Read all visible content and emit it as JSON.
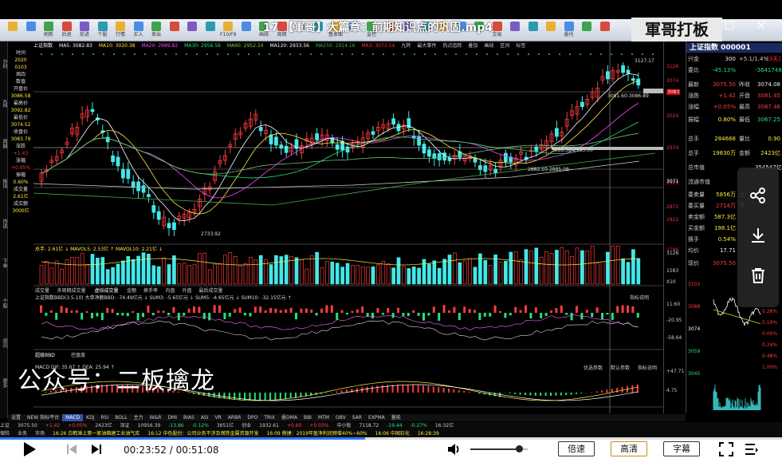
{
  "video": {
    "title": "17 【軍哥】大篇章：前期知识点的巩固.mp4",
    "watermark": "軍哥打板",
    "overlay_text": "公众号：二板擒龙",
    "current_time": "00:23:52",
    "total_time": "00:51:08",
    "progress": 0.467,
    "volume": 0.85,
    "buttons": {
      "speed": "倍速",
      "quality": "高清",
      "subtitle": "字幕"
    }
  },
  "toolbar": {
    "items": [
      "",
      "",
      "刷新",
      "后退",
      "前进",
      "个股",
      "行情",
      "买入",
      "卖出",
      "",
      "",
      "",
      "F10/F9",
      "",
      "画线",
      "周期",
      "",
      "",
      "基本面",
      "",
      "监控",
      "",
      "",
      "",
      "",
      "",
      "",
      "交易",
      "",
      "",
      "",
      "委托",
      "",
      "",
      "",
      "",
      "",
      "F9",
      "",
      "",
      "",
      "",
      "资讯",
      "",
      "",
      "",
      "",
      "",
      "",
      "",
      "",
      "",
      "",
      "",
      "",
      "",
      "",
      "",
      "",
      "",
      "",
      "",
      "",
      "",
      "",
      "",
      "",
      "",
      "",
      "",
      "",
      "",
      "",
      "",
      "",
      "",
      "",
      "",
      "",
      "",
      "",
      "",
      "",
      "",
      "",
      "",
      "",
      "",
      "",
      "",
      "",
      "",
      "",
      "",
      "",
      "",
      "",
      "",
      "",
      "",
      "",
      "",
      "",
      "",
      "",
      "",
      "",
      "",
      "",
      "",
      "",
      "",
      "",
      "",
      "",
      "",
      "",
      "",
      "",
      "",
      "",
      "",
      "",
      "",
      "",
      "",
      "",
      "",
      "",
      "",
      "",
      "",
      "",
      "",
      "",
      "",
      "",
      "",
      "",
      "",
      "",
      "",
      "",
      "",
      "",
      "",
      "",
      "",
      "",
      ""
    ]
  },
  "left_strip": {
    "items": [
      "分时",
      "K线",
      "周期",
      "板块",
      "自选",
      "下单",
      "个股",
      "资讯",
      "更多"
    ]
  },
  "left_info": {
    "lines": [
      "时间",
      "2020",
      "0103",
      "周四",
      "数值",
      "开盘价",
      "3086.58",
      "最高价",
      "3092.82",
      "最低价",
      "3074.52",
      "收盘价",
      "3083.79",
      "涨跌",
      "+1.43",
      "涨幅",
      "+0.05%",
      "振幅",
      "0.60%",
      "成交量",
      "2.61亿",
      "成交额",
      "3000亿"
    ]
  },
  "chart_header": {
    "name": "上证指数",
    "ma5": "MA5: 3082.83",
    "ma10": "MA10: 3020.38",
    "ma20": "MA20: 2989.82",
    "ma30": "MA30: 2956.59",
    "ma60": "MA60: 2952.24",
    "ma120": "MA120: 2933.56",
    "ma250": "MA250: 2914.16",
    "ma3": "MA3: 3073.54",
    "right_tabs": [
      "九转",
      "最大事件",
      "热点追踪",
      "叠加",
      "画线",
      "区间",
      "标签"
    ],
    "colors": {
      "ma5": "#ffffff",
      "ma10": "#ffeb3b",
      "ma20": "#ff44ff",
      "ma30": "#26e07a",
      "ma60": "#8bc34a",
      "ma120": "#ffffff",
      "ma250": "#4caf50",
      "ma3": "#ff3333"
    }
  },
  "price_annotations": {
    "high": "3127.17",
    "low": "2733.92",
    "mid1": "3091.60-3086.89",
    "mid2": "3086.58-2935.00",
    "mid3": "2882.50-2885.08"
  },
  "price_axis": {
    "labels": [
      "3126",
      "3074",
      "3024",
      "2974",
      "2923",
      "2872",
      "2822",
      "2796"
    ],
    "current": "3083",
    "marker1": "3071"
  },
  "volume_panel": {
    "header": "总手: 2.61亿 ↓  MAVOL5: 2.53亿 ↑  MAVOL10: 2.21亿 ↓",
    "tabs": [
      "成交量",
      "多周期成交量",
      "虚拟成交量",
      "金额",
      "换手率",
      "内盘",
      "外盘",
      "最后成交量"
    ],
    "axis": [
      "3126",
      "1583",
      "X10"
    ]
  },
  "ddx_panel": {
    "header": "上证指数BBD(3.5.10) 大单净额BBD: -74.49亿元 ↓  SUM3: -5.65亿元 ↓  SUM5: -4.65亿元 ↓  SUM10: -32.15亿元 ↑",
    "side": "指标说明",
    "axis": [
      "11.60",
      "-20.95",
      "-58.64"
    ]
  },
  "macd_panel": {
    "tabs": [
      "超级BBD",
      "控盘度"
    ],
    "header": "MACD  DIF: 35.67 ↑  DEA: 25.94 ↑",
    "buttons": [
      "优选参数",
      "默认参数",
      "指标说明"
    ],
    "axis": [
      "+47.71",
      "4.75"
    ]
  },
  "indicator_tabs": [
    "设置",
    "NEW 指标平台",
    "MACD",
    "KDJ",
    "RSI",
    "BOLL",
    "主力",
    "W&R",
    "DMI",
    "BIAS",
    "ASI",
    "VR",
    "ARBR",
    "DPO",
    "TRIX",
    "曼DMA",
    "BBI",
    "MTM",
    "OBV",
    "SAR",
    "EXPMA",
    "量能"
  ],
  "quote_panel": {
    "title": "上证指数 000001",
    "rows": [
      {
        "k": "兴金",
        "v": "300",
        "k2": "+5.1/1.4%",
        "v2": "[3天]",
        "vc": "white",
        "v2c": "red"
      },
      {
        "k": "委比",
        "v": "-45.13%",
        "k2": "",
        "v2": "-36417484",
        "vc": "green",
        "v2c": "green"
      },
      {
        "k": "最新",
        "v": "3075.50",
        "k2": "昨收",
        "v2": "3074.08",
        "vc": "red",
        "v2c": "white"
      },
      {
        "k": "涨跌",
        "v": "+1.42",
        "k2": "开盘",
        "v2": "3081.45",
        "vc": "red",
        "v2c": "red"
      },
      {
        "k": "涨幅",
        "v": "+0.05%",
        "k2": "最高",
        "v2": "3087.46",
        "vc": "red",
        "v2c": "red"
      },
      {
        "k": "振幅",
        "v": "0.80%",
        "k2": "最低",
        "v2": "3067.25",
        "vc": "yellow",
        "v2c": "green"
      },
      {
        "k": "总手",
        "v": "284668",
        "k2": "量比",
        "v2": "0.90",
        "vc": "yellow",
        "v2c": "yellow"
      },
      {
        "k": "总手",
        "v": "19830万",
        "k2": "金额",
        "v2": "2423亿",
        "vc": "yellow",
        "v2c": "yellow"
      },
      {
        "k": "总市值",
        "v": "",
        "k2": "",
        "v2": "354547亿",
        "vc": "white",
        "v2c": "white"
      },
      {
        "k": "流通市值",
        "v": "",
        "k2": "",
        "v2": "",
        "vc": "white",
        "v2c": "white"
      },
      {
        "k": "委卖量",
        "v": "5856万",
        "k2": "上",
        "v2": "",
        "vc": "yellow",
        "v2c": "white"
      },
      {
        "k": "委买量",
        "v": "2714万",
        "k2": "下",
        "v2": "",
        "vc": "red",
        "v2c": "white"
      },
      {
        "k": "卖金额",
        "v": "587.3亿",
        "k2": "",
        "v2": "",
        "vc": "yellow",
        "v2c": "white"
      },
      {
        "k": "买金额",
        "v": "198.1亿",
        "k2": "",
        "v2": "",
        "vc": "yellow",
        "v2c": "white"
      },
      {
        "k": "换手",
        "v": "0.54%",
        "k2": "",
        "v2": "",
        "vc": "yellow",
        "v2c": "white"
      },
      {
        "k": "均价",
        "v": "17.71",
        "k2": "",
        "v2": "",
        "vc": "white",
        "v2c": "white"
      },
      {
        "k": "现价",
        "v": "3075.50",
        "k2": "",
        "v2": "",
        "vc": "red",
        "v2c": "white"
      }
    ],
    "mini_axis_left": [
      "3102",
      "3088",
      "3074",
      "3059",
      "3045"
    ],
    "mini_axis_right": [
      "0.28%",
      "0.19%",
      "0.00%",
      "0.24%",
      "0.48%",
      "1.00%"
    ]
  },
  "side_tools": [
    "share-icon",
    "download-icon",
    "trash-icon"
  ],
  "ticker1": [
    "上证",
    "3075.50",
    "+1.42",
    "+0.05%",
    "2423亿",
    "深证",
    "10956.39",
    "-13.86",
    "-0.12%",
    "3651亿",
    "创业",
    "1932.61",
    "+0.60",
    "+0.03%",
    "中小板",
    "7118.72",
    "-19.44",
    "-0.27%",
    "16:32亿"
  ],
  "ticker2": [
    "保险",
    "业务",
    "市场",
    "16:26 白鹤滩上第一家油箱建工业油气库",
    "16:12 中色股份：公司业务不涉及钢铁金属资源开发",
    "16:09 鼎捷：2019年盈净利润预增40%~60%",
    "16:06 中国石化",
    "16:28:39"
  ]
}
